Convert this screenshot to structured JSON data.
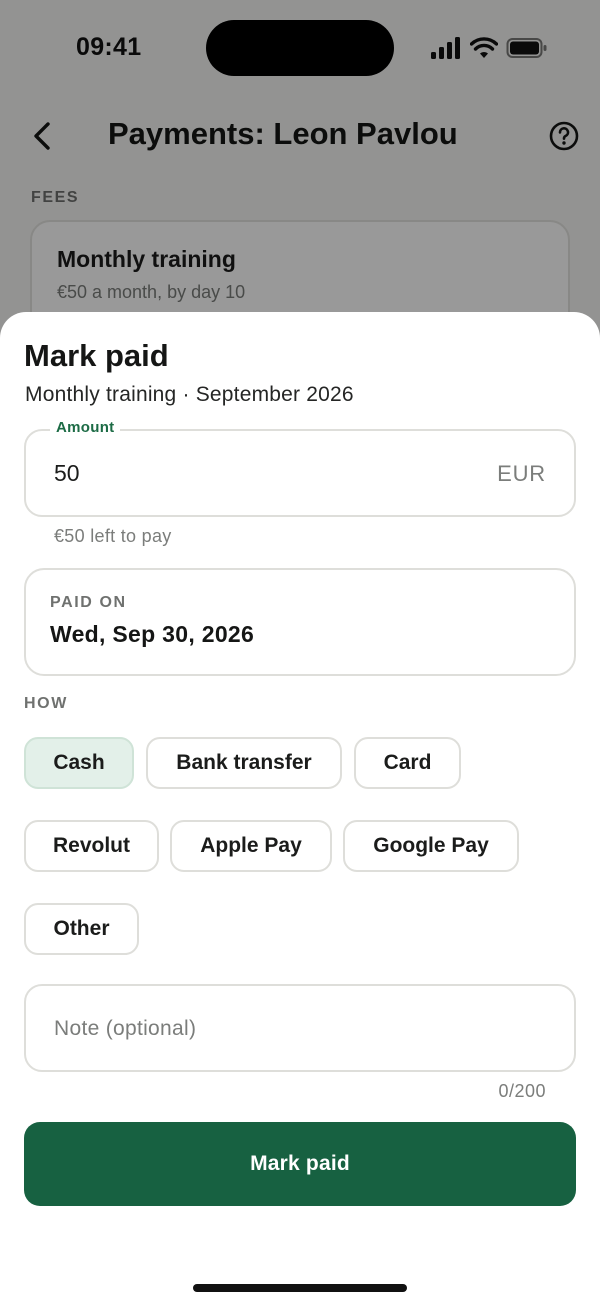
{
  "status_bar": {
    "time": "09:41",
    "icons": [
      "cellular-signal-icon",
      "wifi-icon",
      "battery-icon"
    ]
  },
  "background": {
    "nav": {
      "title": "Payments: Leon Pavlou",
      "back_icon": "chevron-left-icon",
      "help_icon": "help-circle-icon"
    },
    "fees_label": "FEES",
    "fee_card": {
      "title": "Monthly training",
      "subtitle": "€50 a month, by day 10"
    }
  },
  "sheet": {
    "title": "Mark paid",
    "subtitle": "Monthly training · September 2026",
    "amount": {
      "label": "Amount",
      "value": "50",
      "currency": "EUR",
      "helper": "€50 left to pay"
    },
    "paid_on": {
      "label": "PAID ON",
      "value": "Wed, Sep 30, 2026"
    },
    "how_label": "HOW",
    "methods": [
      {
        "label": "Cash",
        "selected": true
      },
      {
        "label": "Bank transfer",
        "selected": false
      },
      {
        "label": "Card",
        "selected": false
      },
      {
        "label": "Revolut",
        "selected": false
      },
      {
        "label": "Apple Pay",
        "selected": false
      },
      {
        "label": "Google Pay",
        "selected": false
      },
      {
        "label": "Other",
        "selected": false
      }
    ],
    "note": {
      "placeholder": "Note (optional)",
      "value": "",
      "counter": "0/200"
    },
    "submit_label": "Mark paid"
  },
  "colors": {
    "accent": "#176141",
    "selected_chip_bg": "#e3f0e9",
    "amount_label": "#1c6b45"
  }
}
